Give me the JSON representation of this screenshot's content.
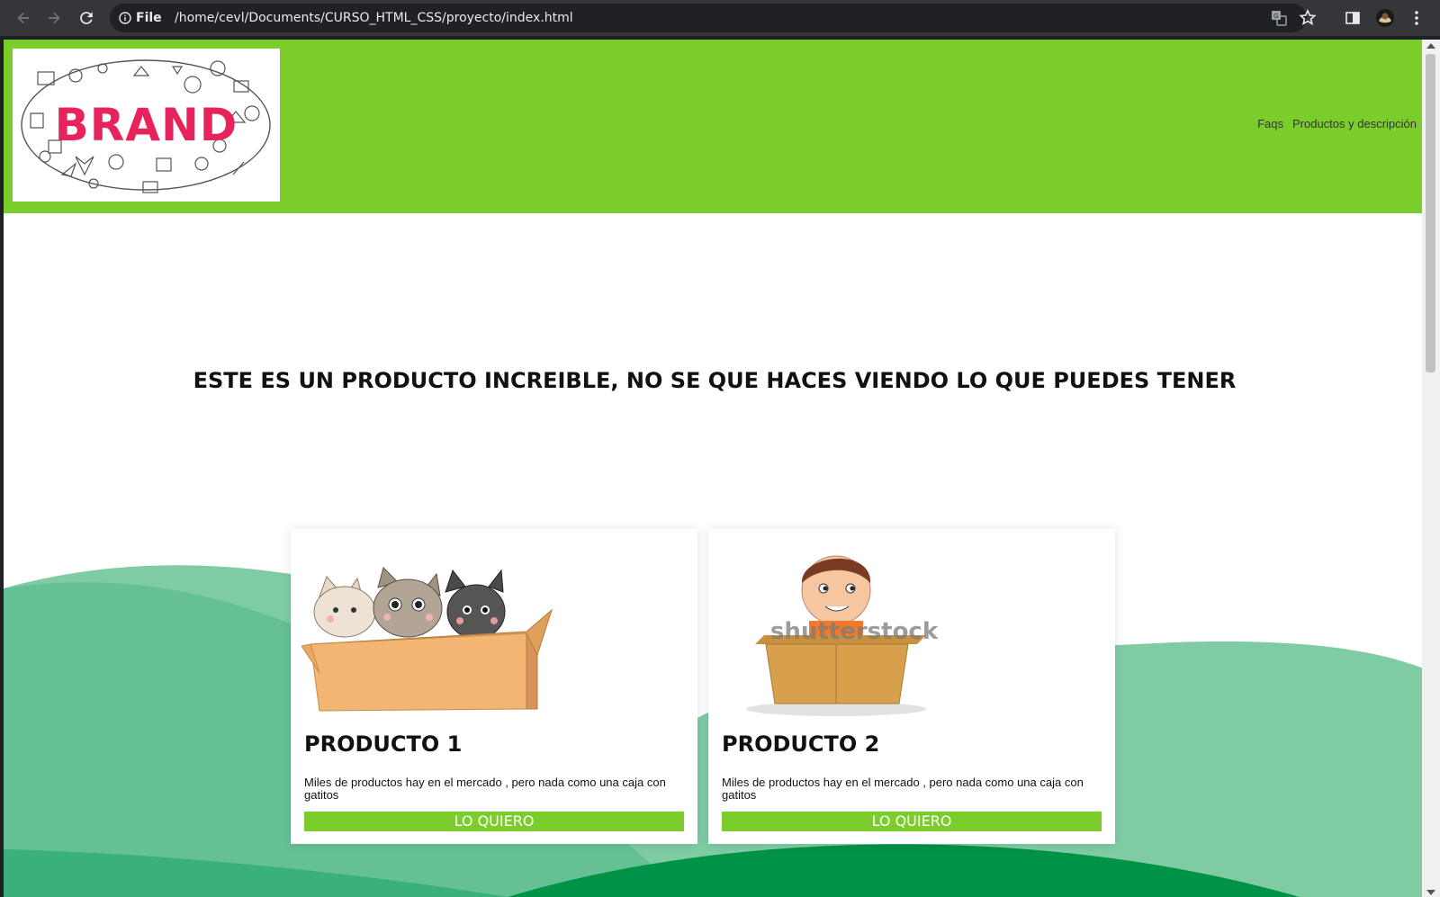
{
  "browser": {
    "info_label": "File",
    "url": "/home/cevl/Documents/CURSO_HTML_CSS/proyecto/index.html",
    "icons": [
      "back-arrow-icon",
      "forward-arrow-icon",
      "reload-icon",
      "info-icon",
      "translate-icon",
      "bookmark-star-icon",
      "side-panel-icon",
      "profile-avatar",
      "menu-dots-icon"
    ]
  },
  "header": {
    "logo_text": "BRAND",
    "nav": [
      "Faqs",
      "Productos y descripción"
    ],
    "colors": {
      "background": "#7bcd2c",
      "logo_text": "#e6235a"
    }
  },
  "hero": {
    "title": "ESTE ES UN PRODUCTO INCREIBLE, NO SE QUE HACES VIENDO LO QUE PUEDES TENER"
  },
  "products": [
    {
      "title": "PRODUCTO 1",
      "description": "Miles de productos hay en el mercado , pero nada como una caja con gatitos",
      "button": "LO QUIERO",
      "image": "cats-in-box-illustration"
    },
    {
      "title": "PRODUCTO 2",
      "description": "Miles de productos hay en el mercado , pero nada como una caja con gatitos",
      "button": "LO QUIERO",
      "image": "boy-in-box-illustration",
      "watermark": "shutterstock"
    }
  ],
  "colors": {
    "wave_light": "#7fcba4",
    "wave_mid": "#3ab07a",
    "wave_dark": "#009245",
    "button": "#7bcd2c"
  }
}
